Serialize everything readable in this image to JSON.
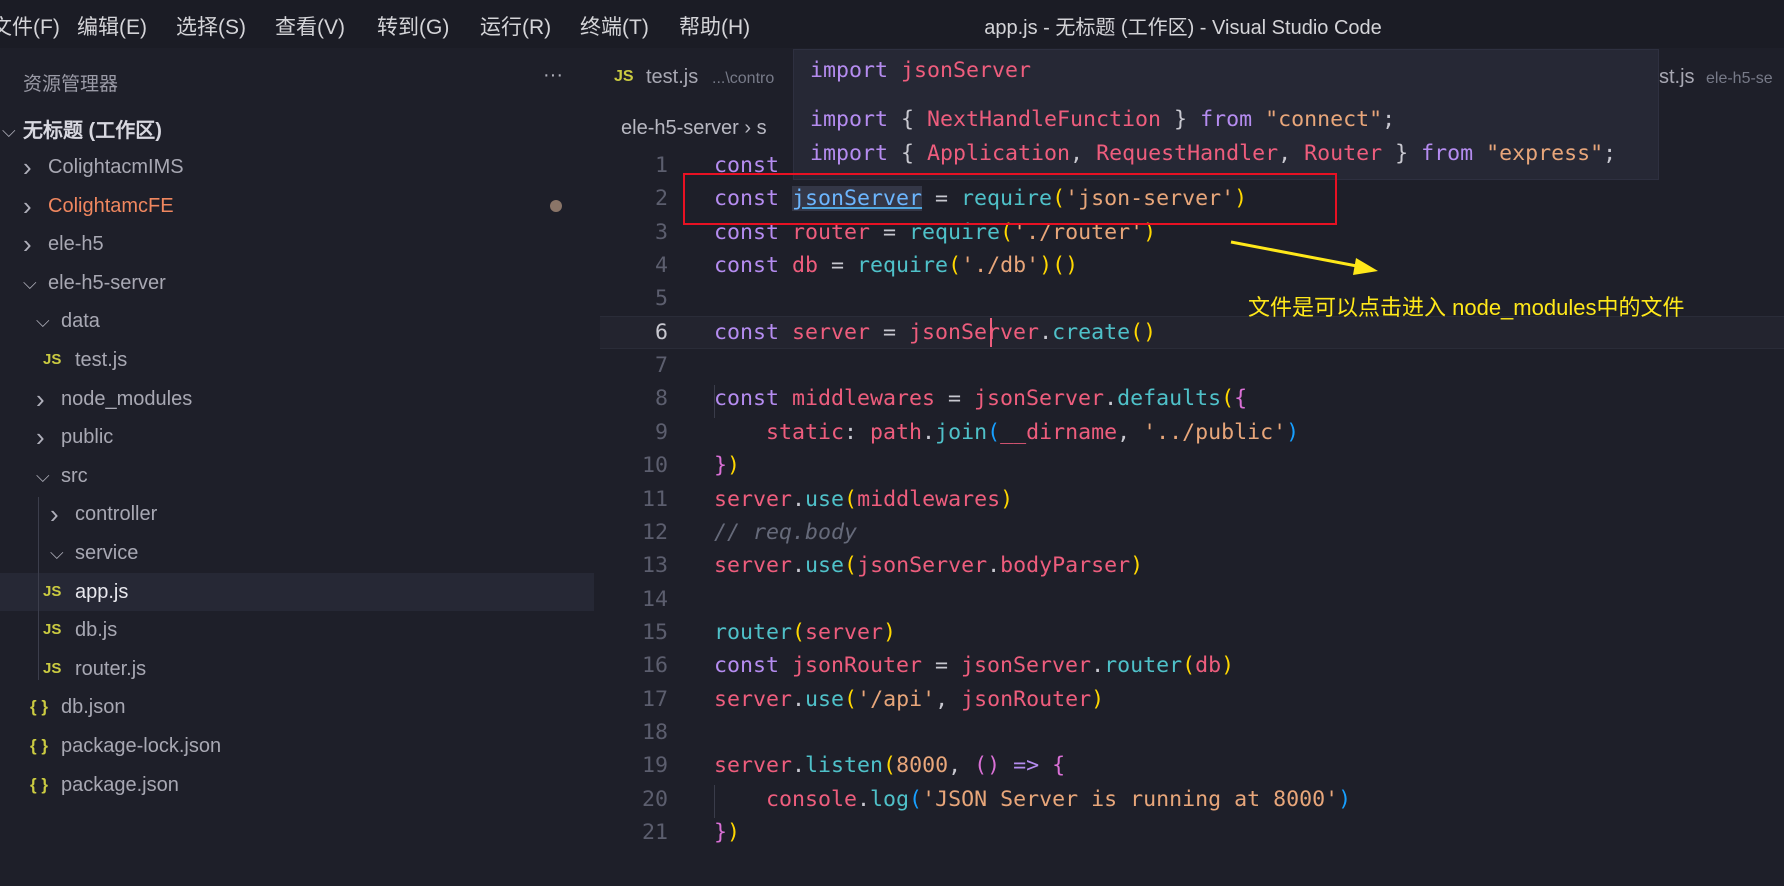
{
  "menu": [
    "文件(F)",
    "编辑(E)",
    "选择(S)",
    "查看(V)",
    "转到(G)",
    "运行(R)",
    "终端(T)",
    "帮助(H)"
  ],
  "window_title": "app.js - 无标题 (工作区) - Visual Studio Code",
  "sidebar": {
    "title": "资源管理器",
    "more": "···",
    "workspace": "无标题 (工作区)",
    "items": [
      {
        "label": "ColightacmIMS",
        "type": "folder",
        "open": false,
        "level": 1
      },
      {
        "label": "ColightamcFE",
        "type": "folder",
        "open": false,
        "level": 1,
        "modified": true
      },
      {
        "label": "ele-h5",
        "type": "folder",
        "open": false,
        "level": 1
      },
      {
        "label": "ele-h5-server",
        "type": "folder",
        "open": true,
        "level": 1
      },
      {
        "label": "data",
        "type": "folder",
        "open": true,
        "level": 2
      },
      {
        "label": "test.js",
        "type": "js",
        "level": 3
      },
      {
        "label": "node_modules",
        "type": "folder",
        "open": false,
        "level": 2
      },
      {
        "label": "public",
        "type": "folder",
        "open": false,
        "level": 2
      },
      {
        "label": "src",
        "type": "folder",
        "open": true,
        "level": 2
      },
      {
        "label": "controller",
        "type": "folder",
        "open": false,
        "level": 3
      },
      {
        "label": "service",
        "type": "folder",
        "open": true,
        "level": 3
      },
      {
        "label": "app.js",
        "type": "js",
        "level": 3,
        "selected": true
      },
      {
        "label": "db.js",
        "type": "js",
        "level": 3
      },
      {
        "label": "router.js",
        "type": "js",
        "level": 3
      },
      {
        "label": "db.json",
        "type": "json",
        "level": 2
      },
      {
        "label": "package-lock.json",
        "type": "json",
        "level": 2
      },
      {
        "label": "package.json",
        "type": "json",
        "level": 2
      }
    ],
    "modified_color": "#f0875f"
  },
  "tabs": [
    {
      "icon": "JS",
      "label": "test.js",
      "hint": "...\\contro"
    },
    {
      "label": "st.js",
      "hint": "ele-h5-se"
    }
  ],
  "breadcrumb": [
    "ele-h5-server",
    "s"
  ],
  "popup": [
    [
      [
        "import ",
        "k"
      ],
      [
        "jsonServer",
        "v"
      ]
    ],
    [
      [
        "import ",
        "k"
      ],
      [
        "{ ",
        "p"
      ],
      [
        "NextHandleFunction",
        "v"
      ],
      [
        " } ",
        "p"
      ],
      [
        "from ",
        "k"
      ],
      [
        "\"connect\"",
        "s"
      ],
      [
        ";",
        "p"
      ]
    ],
    [
      [
        "import ",
        "k"
      ],
      [
        "{ ",
        "p"
      ],
      [
        "Application",
        "v"
      ],
      [
        ", ",
        "p"
      ],
      [
        "RequestHandler",
        "v"
      ],
      [
        ", ",
        "p"
      ],
      [
        "Router",
        "v"
      ],
      [
        " } ",
        "p"
      ],
      [
        "from ",
        "k"
      ],
      [
        "\"express\"",
        "s"
      ],
      [
        ";",
        "p"
      ]
    ]
  ],
  "code": [
    [
      [
        "const ",
        "k"
      ]
    ],
    [
      [
        "const ",
        "k"
      ],
      [
        "jsonServer",
        "lk"
      ],
      [
        " = ",
        "p"
      ],
      [
        "require",
        "f"
      ],
      [
        "(",
        "b1"
      ],
      [
        "'json-server'",
        "s"
      ],
      [
        ")",
        "b1"
      ]
    ],
    [
      [
        "const ",
        "k"
      ],
      [
        "router",
        "v"
      ],
      [
        " = ",
        "p"
      ],
      [
        "require",
        "f"
      ],
      [
        "(",
        "b1"
      ],
      [
        "'./router'",
        "s"
      ],
      [
        ")",
        "b1"
      ]
    ],
    [
      [
        "const ",
        "k"
      ],
      [
        "db",
        "v"
      ],
      [
        " = ",
        "p"
      ],
      [
        "require",
        "f"
      ],
      [
        "(",
        "b1"
      ],
      [
        "'./db'",
        "s"
      ],
      [
        ")",
        "b1"
      ],
      [
        "()",
        "b1"
      ]
    ],
    [],
    [
      [
        "const ",
        "k"
      ],
      [
        "server",
        "v"
      ],
      [
        " = ",
        "p"
      ],
      [
        "jsonServer",
        "v"
      ],
      [
        ".",
        "p"
      ],
      [
        "create",
        "f"
      ],
      [
        "()",
        "b1"
      ]
    ],
    [],
    [
      [
        "const ",
        "k"
      ],
      [
        "middlewares",
        "v"
      ],
      [
        " = ",
        "p"
      ],
      [
        "jsonServer",
        "v"
      ],
      [
        ".",
        "p"
      ],
      [
        "defaults",
        "f"
      ],
      [
        "(",
        "b1"
      ],
      [
        "{",
        "b2"
      ]
    ],
    [
      [
        "    static",
        "v"
      ],
      [
        ": ",
        "p"
      ],
      [
        "path",
        "v"
      ],
      [
        ".",
        "p"
      ],
      [
        "join",
        "f"
      ],
      [
        "(",
        "b3"
      ],
      [
        "__dirname",
        "v"
      ],
      [
        ", ",
        "p"
      ],
      [
        "'../public'",
        "s"
      ],
      [
        ")",
        "b3"
      ]
    ],
    [
      [
        "}",
        "b2"
      ],
      [
        ")",
        "b1"
      ]
    ],
    [
      [
        "server",
        "v"
      ],
      [
        ".",
        "p"
      ],
      [
        "use",
        "f"
      ],
      [
        "(",
        "b1"
      ],
      [
        "middlewares",
        "v"
      ],
      [
        ")",
        "b1"
      ]
    ],
    [
      [
        "// req.body",
        "cm"
      ]
    ],
    [
      [
        "server",
        "v"
      ],
      [
        ".",
        "p"
      ],
      [
        "use",
        "f"
      ],
      [
        "(",
        "b1"
      ],
      [
        "jsonServer",
        "v"
      ],
      [
        ".",
        "p"
      ],
      [
        "bodyParser",
        "v"
      ],
      [
        ")",
        "b1"
      ]
    ],
    [],
    [
      [
        "router",
        "f"
      ],
      [
        "(",
        "b1"
      ],
      [
        "server",
        "v"
      ],
      [
        ")",
        "b1"
      ]
    ],
    [
      [
        "const ",
        "k"
      ],
      [
        "jsonRouter",
        "v"
      ],
      [
        " = ",
        "p"
      ],
      [
        "jsonServer",
        "v"
      ],
      [
        ".",
        "p"
      ],
      [
        "router",
        "f"
      ],
      [
        "(",
        "b1"
      ],
      [
        "db",
        "v"
      ],
      [
        ")",
        "b1"
      ]
    ],
    [
      [
        "server",
        "v"
      ],
      [
        ".",
        "p"
      ],
      [
        "use",
        "f"
      ],
      [
        "(",
        "b1"
      ],
      [
        "'/api'",
        "s"
      ],
      [
        ", ",
        "p"
      ],
      [
        "jsonRouter",
        "v"
      ],
      [
        ")",
        "b1"
      ]
    ],
    [],
    [
      [
        "server",
        "v"
      ],
      [
        ".",
        "p"
      ],
      [
        "listen",
        "f"
      ],
      [
        "(",
        "b1"
      ],
      [
        "8000",
        "s"
      ],
      [
        ", ",
        "p"
      ],
      [
        "()",
        "b2"
      ],
      [
        " => ",
        "k"
      ],
      [
        "{",
        "b2"
      ]
    ],
    [
      [
        "    console",
        "v"
      ],
      [
        ".",
        "p"
      ],
      [
        "log",
        "f"
      ],
      [
        "(",
        "b3"
      ],
      [
        "'JSON Server is running at 8000'",
        "s"
      ],
      [
        ")",
        "b3"
      ]
    ],
    [
      [
        "}",
        "b2"
      ],
      [
        ")",
        "b1"
      ]
    ]
  ],
  "current_line": 6,
  "annotation": {
    "text": "文件是可以点击进入 node_modules中的文件",
    "color": "#ffe81a",
    "box_color": "#e81123"
  }
}
